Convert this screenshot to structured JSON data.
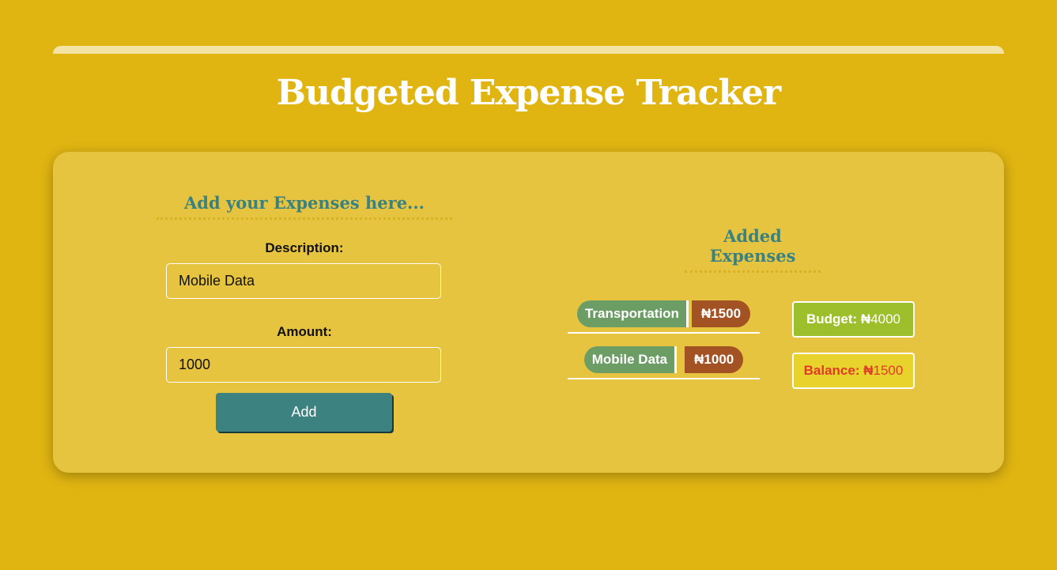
{
  "app": {
    "title": "Budgeted Expense Tracker"
  },
  "form": {
    "heading": "Add your Expenses here...",
    "description_label": "Description:",
    "description_value": "Mobile Data",
    "amount_label": "Amount:",
    "amount_value": "1000",
    "add_label": "Add"
  },
  "expenses": {
    "heading": "Added Expenses",
    "items": [
      {
        "description": "Transportation",
        "amount": "₦1500"
      },
      {
        "description": "Mobile Data",
        "amount": "₦1000"
      }
    ]
  },
  "summary": {
    "budget_label": "Budget: ₦",
    "budget_value": "4000",
    "balance_label": "Balance: ₦",
    "balance_value": "1500"
  },
  "colors": {
    "background": "#e0b512",
    "card": "#e7c440",
    "accent": "#3b8281",
    "desc_pill": "#6c9d65",
    "amount_pill": "#a35223",
    "budget": "#9ebf2c",
    "balance_text": "#e03a2a"
  }
}
